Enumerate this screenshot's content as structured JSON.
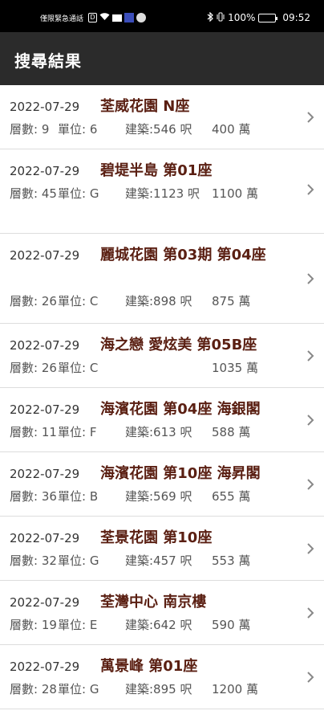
{
  "status_bar": {
    "carrier": "僅限緊急通話",
    "time": "09:52",
    "battery": "100%"
  },
  "app_bar": {
    "title": "搜尋結果"
  },
  "results": [
    {
      "date": "2022-07-29",
      "name": "荃威花園 N座",
      "floor": "層數: 9",
      "unit": "單位: 6",
      "area": "建築:546 呎",
      "price": "400 萬"
    },
    {
      "date": "2022-07-29",
      "name": "碧堤半島 第01座",
      "floor": "層數: 45",
      "unit": "單位: G",
      "area": "建築:1123 呎",
      "price": "1100 萬"
    },
    {
      "date": "2022-07-29",
      "name": "麗城花園 第03期 第04座",
      "floor": "層數: 26",
      "unit": "單位: C",
      "area": "建築:898 呎",
      "price": "875 萬"
    },
    {
      "date": "2022-07-29",
      "name": "海之戀 愛炫美 第05B座",
      "floor": "層數: 26",
      "unit": "單位: C",
      "area": "",
      "price": "1035 萬"
    },
    {
      "date": "2022-07-29",
      "name": "海濱花園 第04座 海銀閣",
      "floor": "層數: 11",
      "unit": "單位: F",
      "area": "建築:613 呎",
      "price": "588 萬"
    },
    {
      "date": "2022-07-29",
      "name": "海濱花園 第10座 海昇閣",
      "floor": "層數: 36",
      "unit": "單位: B",
      "area": "建築:569 呎",
      "price": "655 萬"
    },
    {
      "date": "2022-07-29",
      "name": "荃景花園 第10座",
      "floor": "層數: 32",
      "unit": "單位: G",
      "area": "建築:457 呎",
      "price": "553 萬"
    },
    {
      "date": "2022-07-29",
      "name": "荃灣中心 南京樓",
      "floor": "層數: 19",
      "unit": "單位: E",
      "area": "建築:642 呎",
      "price": "590 萬"
    },
    {
      "date": "2022-07-29",
      "name": "萬景峰 第01座",
      "floor": "層數: 28",
      "unit": "單位: G",
      "area": "建築:895 呎",
      "price": "1200 萬"
    }
  ]
}
